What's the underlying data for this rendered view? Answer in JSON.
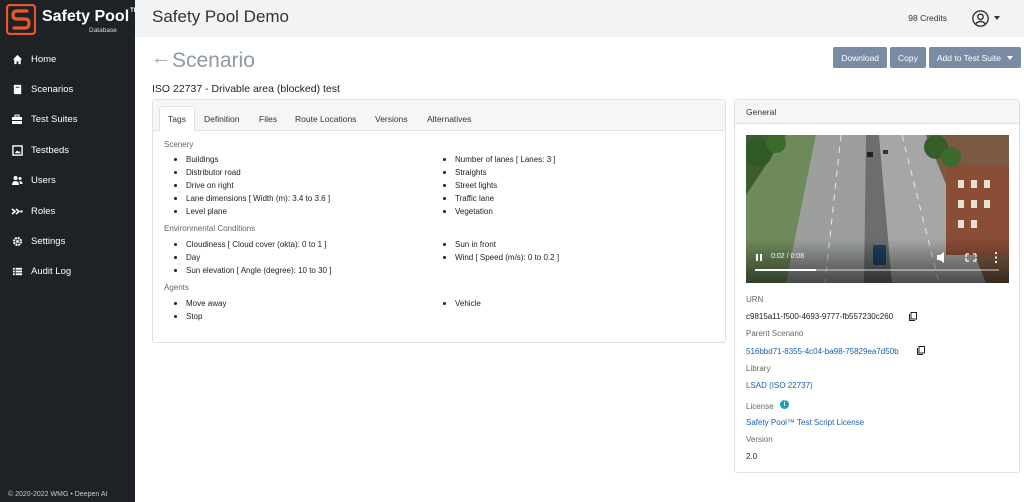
{
  "brand": {
    "name": "Safety Pool",
    "tm": "TM",
    "sub": "Database"
  },
  "nav": [
    {
      "label": "Home",
      "icon": "home-icon"
    },
    {
      "label": "Scenarios",
      "icon": "book-icon"
    },
    {
      "label": "Test Suites",
      "icon": "toolbox-icon"
    },
    {
      "label": "Testbeds",
      "icon": "image-icon"
    },
    {
      "label": "Users",
      "icon": "users-icon"
    },
    {
      "label": "Roles",
      "icon": "routes-icon"
    },
    {
      "label": "Settings",
      "icon": "gear-icon"
    },
    {
      "label": "Audit Log",
      "icon": "list-icon"
    }
  ],
  "footer": "© 2020-2022 WMG • Deepen AI",
  "topbar": {
    "title": "Safety Pool Demo",
    "credits": "98 Credits"
  },
  "page": {
    "back": "←",
    "title": "Scenario",
    "subtitle": "ISO 22737 - Drivable area (blocked) test",
    "buttons": {
      "download": "Download",
      "copy": "Copy",
      "add": "Add to Test Suite"
    }
  },
  "tabs": [
    "Tags",
    "Definition",
    "Files",
    "Route Locations",
    "Versions",
    "Alternatives"
  ],
  "tags": {
    "scenery_title": "Scenery",
    "scenery_left": [
      "Buildings",
      "Distributor road",
      "Drive on right",
      "Lane dimensions [ Width (m): 3.4 to 3.6 ]",
      "Level plane"
    ],
    "scenery_right": [
      "Number of lanes [ Lanes: 3 ]",
      "Straights",
      "Street lights",
      "Traffic lane",
      "Vegetation"
    ],
    "env_title": "Environmental Conditions",
    "env_left": [
      "Cloudiness [ Cloud cover (okta): 0 to 1 ]",
      "Day",
      "Sun elevation [ Angle (degree): 10 to 30 ]"
    ],
    "env_right": [
      "Sun in front",
      "Wind [ Speed (m/s): 0 to 0.2 ]"
    ],
    "agents_title": "Agents",
    "agents_left": [
      "Move away",
      "Stop"
    ],
    "agents_right": [
      "Vehicle"
    ]
  },
  "general": {
    "header": "General",
    "video_time": "0:02 / 0:08",
    "video_progress": 0.25,
    "urn_label": "URN",
    "urn": "c9815a11-f500-4693-9777-fb557230c260",
    "parent_label": "Parent Scenario",
    "parent": "516bbd71-8355-4c04-ba98-75829ea7d50b",
    "library_label": "Library",
    "library": "LSAD (ISO 22737)",
    "license_label": "License",
    "license": "Safety Pool™ Test Script License",
    "version_label": "Version",
    "version": "2.0"
  },
  "colors": {
    "sidebar": "#1e2125",
    "accent": "#e8582a",
    "button": "#7a8ca3",
    "link": "#1a5fb4"
  }
}
